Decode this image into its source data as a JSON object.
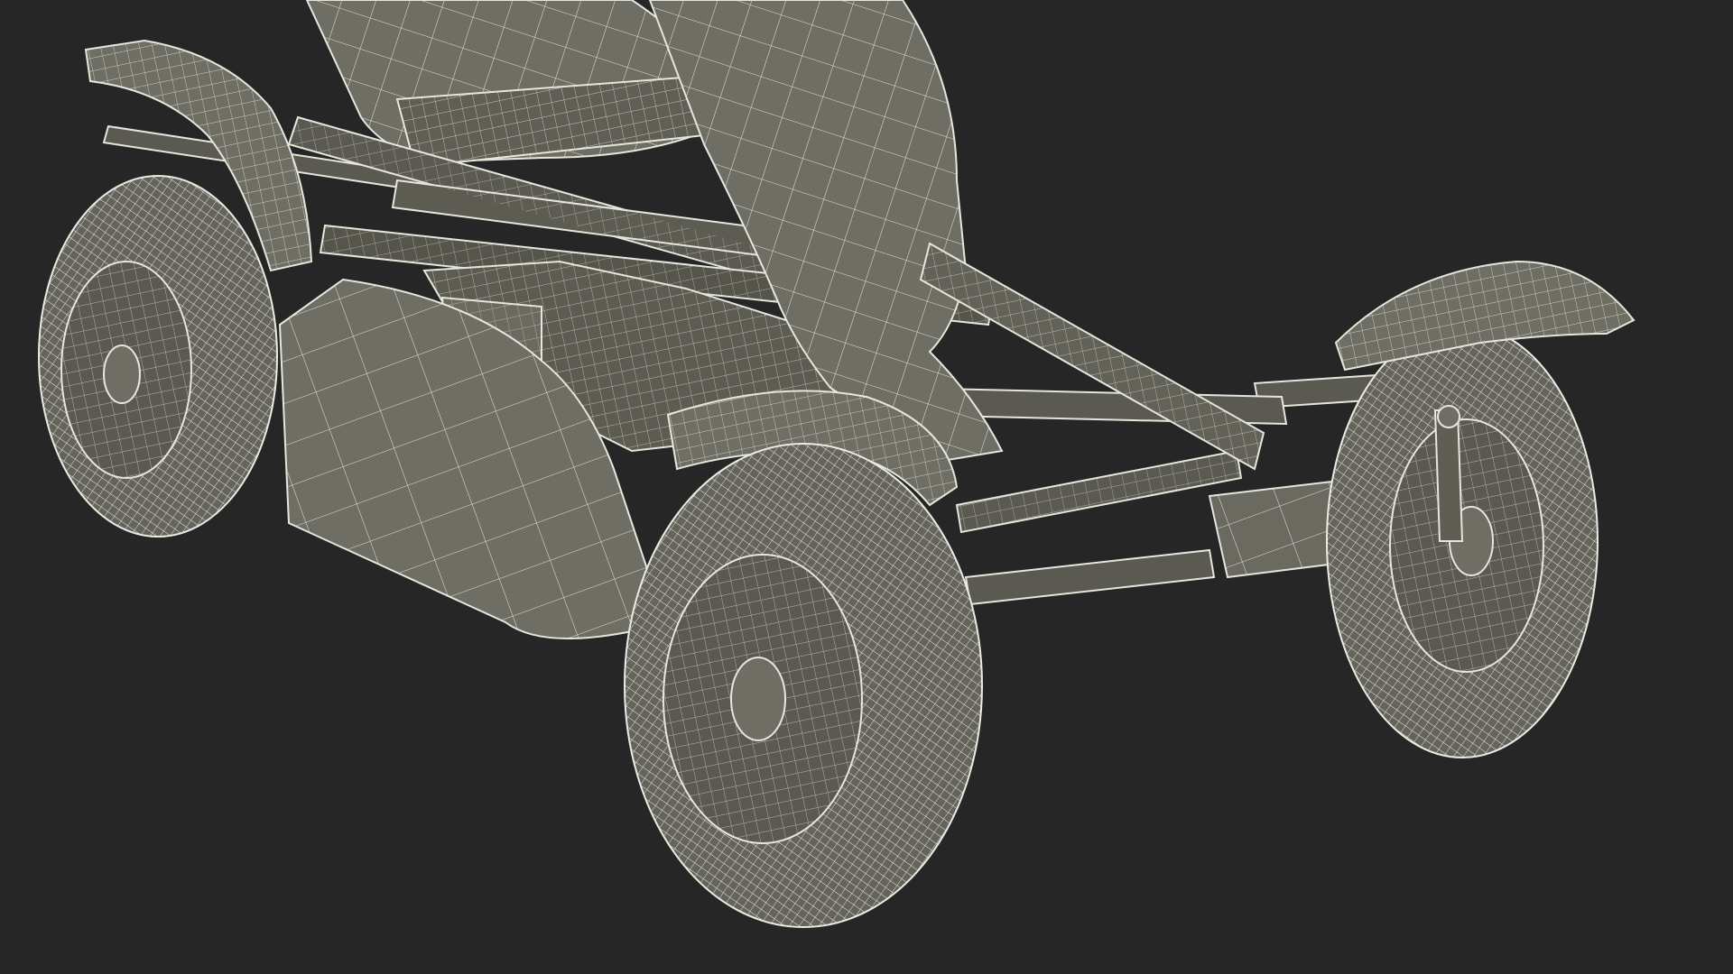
{
  "scene": {
    "subject": "wireframe-kart-model",
    "background_color": "#262626",
    "surface_color": "#6e6e64",
    "surface_dark_color": "#55554c",
    "wire_color": "#e7e6dc",
    "tire_color": "#64645c"
  }
}
